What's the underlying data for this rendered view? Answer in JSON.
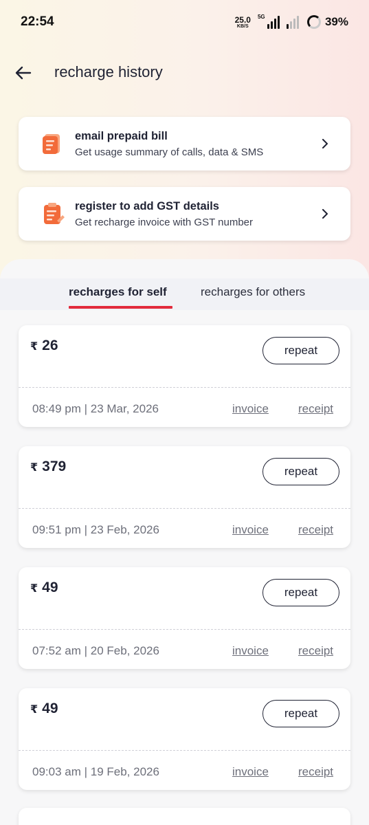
{
  "status_bar": {
    "time": "22:54",
    "net_speed_value": "25.0",
    "net_speed_unit": "KB/S",
    "network_type": "5G",
    "battery": "39%"
  },
  "header": {
    "title": "recharge history"
  },
  "promos": [
    {
      "title": "email prepaid bill",
      "subtitle": "Get usage summary of calls, data & SMS"
    },
    {
      "title": "register to add GST details",
      "subtitle": "Get recharge invoice with GST number"
    }
  ],
  "tabs": {
    "self": "recharges for self",
    "others": "recharges for others",
    "active": "self"
  },
  "currency_symbol": "₹",
  "repeat_label": "repeat",
  "invoice_label": "invoice",
  "receipt_label": "receipt",
  "recharges": [
    {
      "amount": "26",
      "datetime": "08:49 pm | 23 Mar, 2026"
    },
    {
      "amount": "379",
      "datetime": "09:51 pm | 23 Feb, 2026"
    },
    {
      "amount": "49",
      "datetime": "07:52 am | 20 Feb, 2026"
    },
    {
      "amount": "49",
      "datetime": "09:03 am | 19 Feb, 2026"
    }
  ],
  "colors": {
    "accent": "#e22b3c",
    "text_dark": "#1f2233",
    "text_muted": "#6d6f7a",
    "icon_orange": "#f26b3a"
  }
}
